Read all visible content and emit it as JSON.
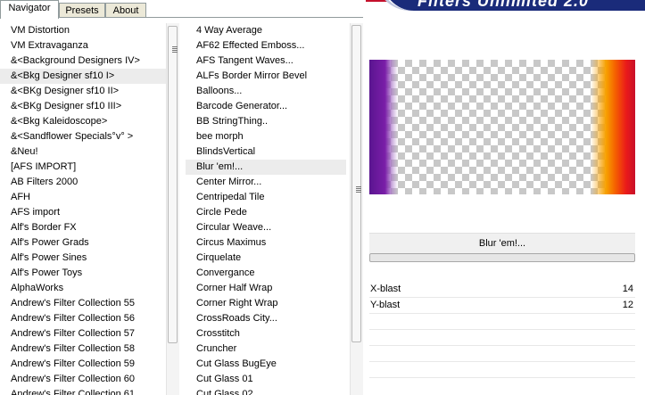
{
  "tabs": [
    "Navigator",
    "Presets",
    "About"
  ],
  "banner": {
    "title": "Filters Unlimited 2.0"
  },
  "categories": [
    "VM Distortion",
    "VM Extravaganza",
    "&<Background Designers IV>",
    "&<Bkg Designer sf10 I>",
    "&<BKg Designer sf10 II>",
    "&<BKg Designer sf10 III>",
    "&<Bkg Kaleidoscope>",
    "&<Sandflower Specials°v° >",
    "&Neu!",
    "[AFS IMPORT]",
    "AB Filters 2000",
    "AFH",
    "AFS import",
    "Alf's Border FX",
    "Alf's Power Grads",
    "Alf's Power Sines",
    "Alf's Power Toys",
    "AlphaWorks",
    "Andrew's Filter Collection 55",
    "Andrew's Filter Collection 56",
    "Andrew's Filter Collection 57",
    "Andrew's Filter Collection 58",
    "Andrew's Filter Collection 59",
    "Andrew's Filter Collection 60",
    "Andrew's Filter Collection 61"
  ],
  "selected_category_index": 3,
  "filters": [
    "4 Way Average",
    "AF62 Effected Emboss...",
    "AFS Tangent Waves...",
    "ALFs Border Mirror Bevel",
    "Balloons...",
    "Barcode Generator...",
    "BB StringThing..",
    "bee morph",
    "BlindsVertical",
    "Blur 'em!...",
    "Center Mirror...",
    "Centripedal Tile",
    "Circle Pede",
    "Circular Weave...",
    "Circus Maximus",
    "Cirquelate",
    "Convergance",
    "Corner Half Wrap",
    "Corner Right Wrap",
    "CrossRoads City...",
    "Crosstitch",
    "Cruncher",
    "Cut Glass  BugEye",
    "Cut Glass 01",
    "Cut Glass 02"
  ],
  "selected_filter_index": 9,
  "current_filter": "Blur 'em!...",
  "params": [
    {
      "name": "X-blast",
      "value": "14"
    },
    {
      "name": "Y-blast",
      "value": "12"
    }
  ],
  "colors": {
    "banner": "#1a2b7a",
    "banner_accent": "#c4102b",
    "preview_left": "#6a1a9a",
    "preview_right": "#e8201a"
  },
  "icons": {
    "scroll_grip": "grip-lines-icon"
  }
}
